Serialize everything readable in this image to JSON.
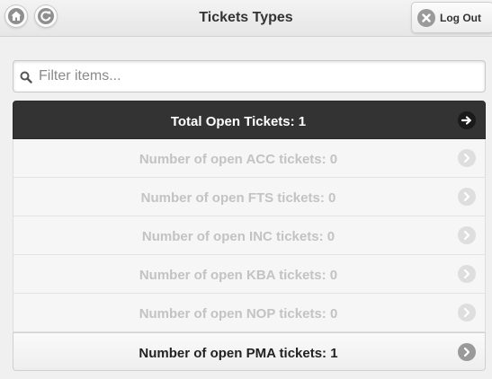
{
  "header": {
    "title": "Tickets Types",
    "logout_label": "Log Out"
  },
  "filter": {
    "placeholder": "Filter items...",
    "value": ""
  },
  "list": {
    "total": {
      "label": "Total Open Tickets: 1"
    },
    "items": [
      {
        "label": "Number of open ACC tickets: 0",
        "count": 0
      },
      {
        "label": "Number of open FTS tickets: 0",
        "count": 0
      },
      {
        "label": "Number of open INC tickets: 0",
        "count": 0
      },
      {
        "label": "Number of open KBA tickets: 0",
        "count": 0
      },
      {
        "label": "Number of open NOP tickets: 0",
        "count": 0
      },
      {
        "label": "Number of open PMA tickets: 1",
        "count": 1
      }
    ]
  },
  "colors": {
    "header_bar": "#333333",
    "disabled_text": "#c3c3c3",
    "active_text": "#222222",
    "icon_gray": "#9a9a9a"
  },
  "icons": {
    "home": "home-icon",
    "refresh": "refresh-icon",
    "logout": "close-icon",
    "search": "search-icon",
    "arrow": "arrow-right-icon"
  }
}
